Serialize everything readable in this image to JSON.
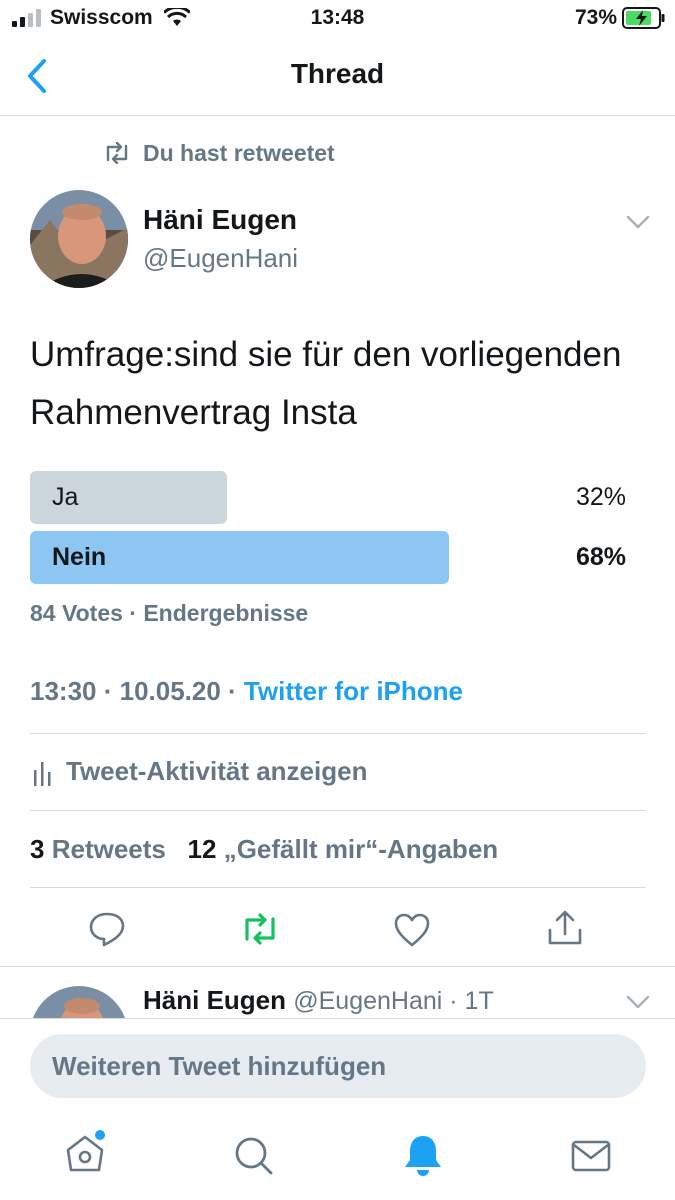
{
  "status_bar": {
    "carrier": "Swisscom",
    "time": "13:48",
    "battery": "73%"
  },
  "nav": {
    "title": "Thread"
  },
  "tweet": {
    "retweet_context": "Du hast retweetet",
    "author_name": "Häni Eugen",
    "author_handle": "@EugenHani",
    "text": "Umfrage:sind sie für den vorliegenden Rahmenvertrag Insta",
    "poll": {
      "options": [
        {
          "label": "Ja",
          "percent": "32%",
          "value": 32,
          "winner": false
        },
        {
          "label": "Nein",
          "percent": "68%",
          "value": 68,
          "winner": true
        }
      ],
      "summary": "84 Votes · Endergebnisse"
    },
    "timestamp": "13:30 · 10.05.20 · ",
    "source": "Twitter for iPhone",
    "activity_label": "Tweet-Aktivität anzeigen",
    "retweet_count": "3",
    "retweet_label": "Retweets",
    "like_count": "12",
    "like_label": "„Gefällt mir“-Angaben"
  },
  "reply": {
    "author_name": "Häni Eugen",
    "author_handle": "@EugenHani · 1T"
  },
  "compose": {
    "placeholder": "Weiteren Tweet hinzufügen"
  },
  "colors": {
    "accent": "#1da1f2",
    "retweet_green": "#17bf63",
    "poll_winner": "#8ec6f3",
    "poll_other": "#ccd6dd"
  }
}
